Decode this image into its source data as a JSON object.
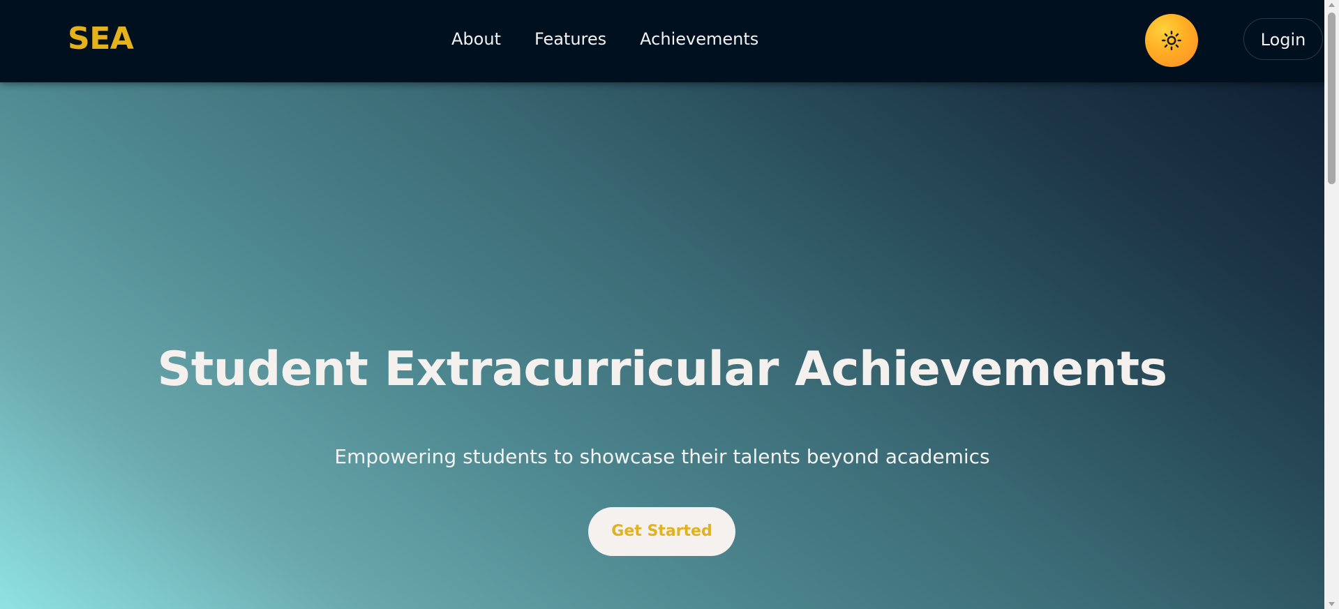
{
  "navbar": {
    "brand": "SEA",
    "links": [
      {
        "label": "About"
      },
      {
        "label": "Features"
      },
      {
        "label": "Achievements"
      }
    ],
    "theme_toggle_icon": "sun-icon",
    "login_label": "Login"
  },
  "hero": {
    "title": "Student Extracurricular Achievements",
    "subtitle": "Empowering students to showcase their talents beyond academics",
    "cta_label": "Get Started"
  },
  "colors": {
    "brand_gold": "#e5b21b",
    "navbar_bg": "#01101f",
    "toggle_orange": "#ffad24",
    "hero_gradient_start": "#8fe2e3",
    "hero_gradient_end": "#0f2033",
    "cta_bg": "#f5f1ef"
  }
}
